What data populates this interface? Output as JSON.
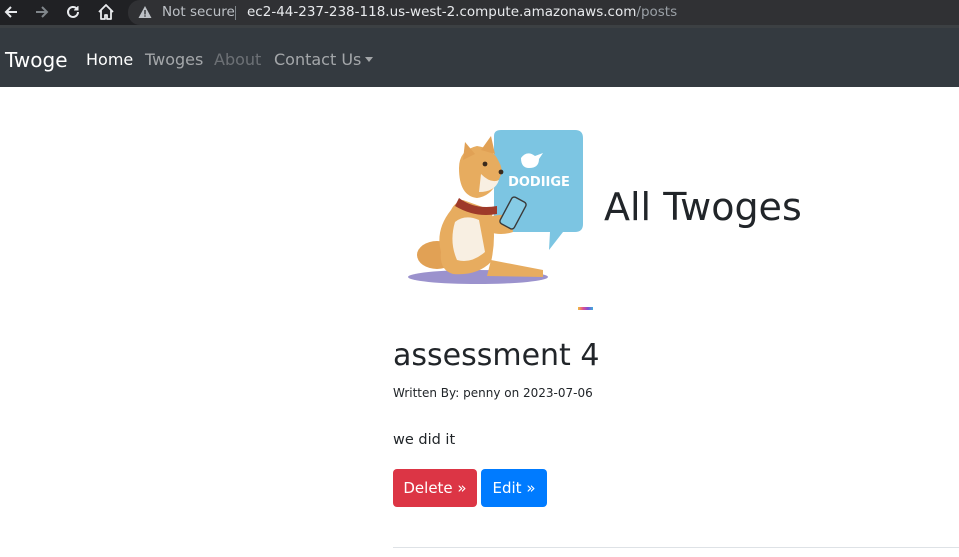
{
  "browser": {
    "security_label": "Not secure",
    "url_host": "ec2-44-237-238-118.us-west-2.compute.amazonaws.com",
    "url_path": "/posts"
  },
  "navbar": {
    "brand": "Twoge",
    "links": [
      {
        "label": "Home",
        "state": "active"
      },
      {
        "label": "Twoges",
        "state": "normal"
      },
      {
        "label": "About",
        "state": "disabled"
      },
      {
        "label": "Contact Us",
        "state": "dropdown"
      }
    ]
  },
  "page": {
    "title": "All Twoges",
    "logo_text": "DODIIGE"
  },
  "post": {
    "title": "assessment 4",
    "meta": "Written By: penny on 2023-07-06",
    "body": "we did it",
    "delete_label": "Delete »",
    "edit_label": "Edit »"
  },
  "colors": {
    "navbar": "#343a40",
    "danger": "#dc3545",
    "primary": "#007bff"
  }
}
